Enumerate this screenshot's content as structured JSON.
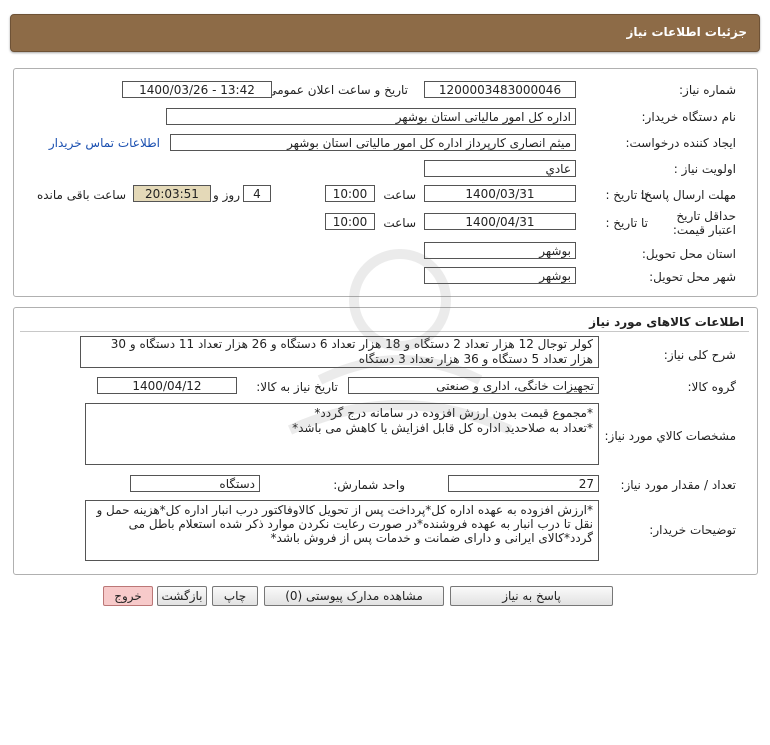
{
  "header": {
    "title": "جزئیات اطلاعات نیاز"
  },
  "need": {
    "number_label": "شماره نیاز:",
    "number_value": "1200003483000046",
    "announce_label": "تاریخ و ساعت اعلان عمومی:",
    "announce_value": "1400/03/26 - 13:42",
    "buyer_label": "نام دستگاه خریدار:",
    "buyer_value": "اداره کل امور مالیاتی استان بوشهر",
    "creator_label": "ایجاد کننده درخواست:",
    "creator_value": "میثم انصاری کارپرداز اداره کل امور مالیاتی استان بوشهر",
    "contact_link": "اطلاعات تماس خریدار",
    "priority_label": "اولویت نیاز :",
    "priority_value": "عادي",
    "deadline_label": "مهلت ارسال پاسخ:",
    "to_date_label": "تا تاریخ :",
    "deadline_date": "1400/03/31",
    "time_label": "ساعت",
    "deadline_time": "10:00",
    "days_value": "4",
    "days_label": "روز و",
    "remaining_value": "20:03:51",
    "remaining_label": "ساعت باقی مانده",
    "validity_label": "حداقل تاریخ اعتبار قیمت:",
    "validity_date": "1400/04/31",
    "validity_time": "10:00",
    "province_label": "استان محل تحویل:",
    "province_value": "بوشهر",
    "city_label": "شهر محل تحویل:",
    "city_value": "بوشهر"
  },
  "goods": {
    "section_title": "اطلاعات کالاهای مورد نیاز",
    "desc_label": "شرح کلی نیاز:",
    "desc_value": "کولر توجال  12 هزار تعداد 2 دستگاه و  18 هزار تعداد 6 دستگاه و  26 هزار تعداد 11 دستگاه و 30 هزار تعداد 5 دستگاه و 36 هزار تعداد 3 دستگاه",
    "group_label": "گروه کالا:",
    "group_value": "تجهیزات خانگی، اداری و صنعتی",
    "need_date_label": "تاریخ نیاز به کالا:",
    "need_date_value": "1400/04/12",
    "spec_label": "مشخصات کالاي مورد نیاز:",
    "spec_line1": "*مجموع قیمت بدون ارزش افزوده در سامانه درج گردد*",
    "spec_line2": "*تعداد به صلاحدید اداره کل قابل افزایش یا کاهش می باشد*",
    "qty_label": "تعداد / مقدار مورد نیاز:",
    "qty_value": "27",
    "unit_label": "واحد شمارش:",
    "unit_value": "دستگاه",
    "notes_label": "توضیحات خریدار:",
    "notes_value": "*ارزش افزوده به عهده اداره کل*پرداخت پس از تحویل کالاوفاکتور درب انبار اداره کل*هزینه حمل و نقل تا درب انبار به عهده فروشنده*در صورت رعایت نکردن موارد ذکر شده استعلام باطل می گردد*کالای ایرانی و دارای ضمانت و خدمات پس از فروش باشد*"
  },
  "actions": {
    "reply": "پاسخ به نیاز",
    "attachments": "مشاهده مدارک پیوستی (0)",
    "print": "چاپ",
    "back": "بازگشت",
    "exit": "خروج"
  }
}
